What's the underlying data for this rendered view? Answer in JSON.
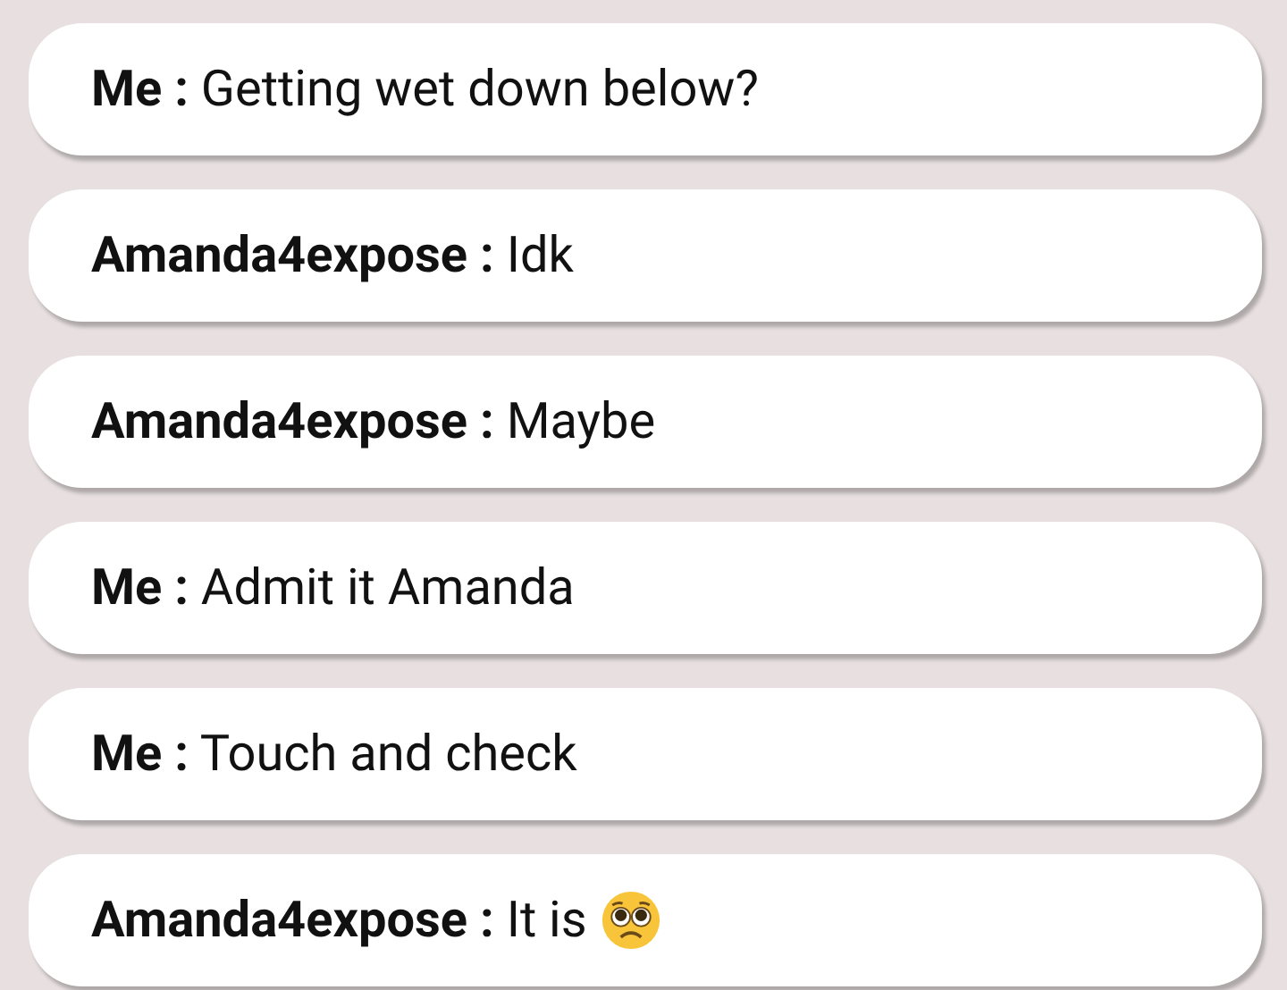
{
  "messages": [
    {
      "sender": "Me :",
      "text": "Getting wet down below?",
      "emoji": false
    },
    {
      "sender": "Amanda4expose :",
      "text": "Idk",
      "emoji": false
    },
    {
      "sender": "Amanda4expose :",
      "text": "Maybe",
      "emoji": false
    },
    {
      "sender": "Me :",
      "text": "Admit it Amanda",
      "emoji": false
    },
    {
      "sender": "Me :",
      "text": "Touch and check",
      "emoji": false
    },
    {
      "sender": "Amanda4expose :",
      "text": "It is",
      "emoji": true
    }
  ]
}
